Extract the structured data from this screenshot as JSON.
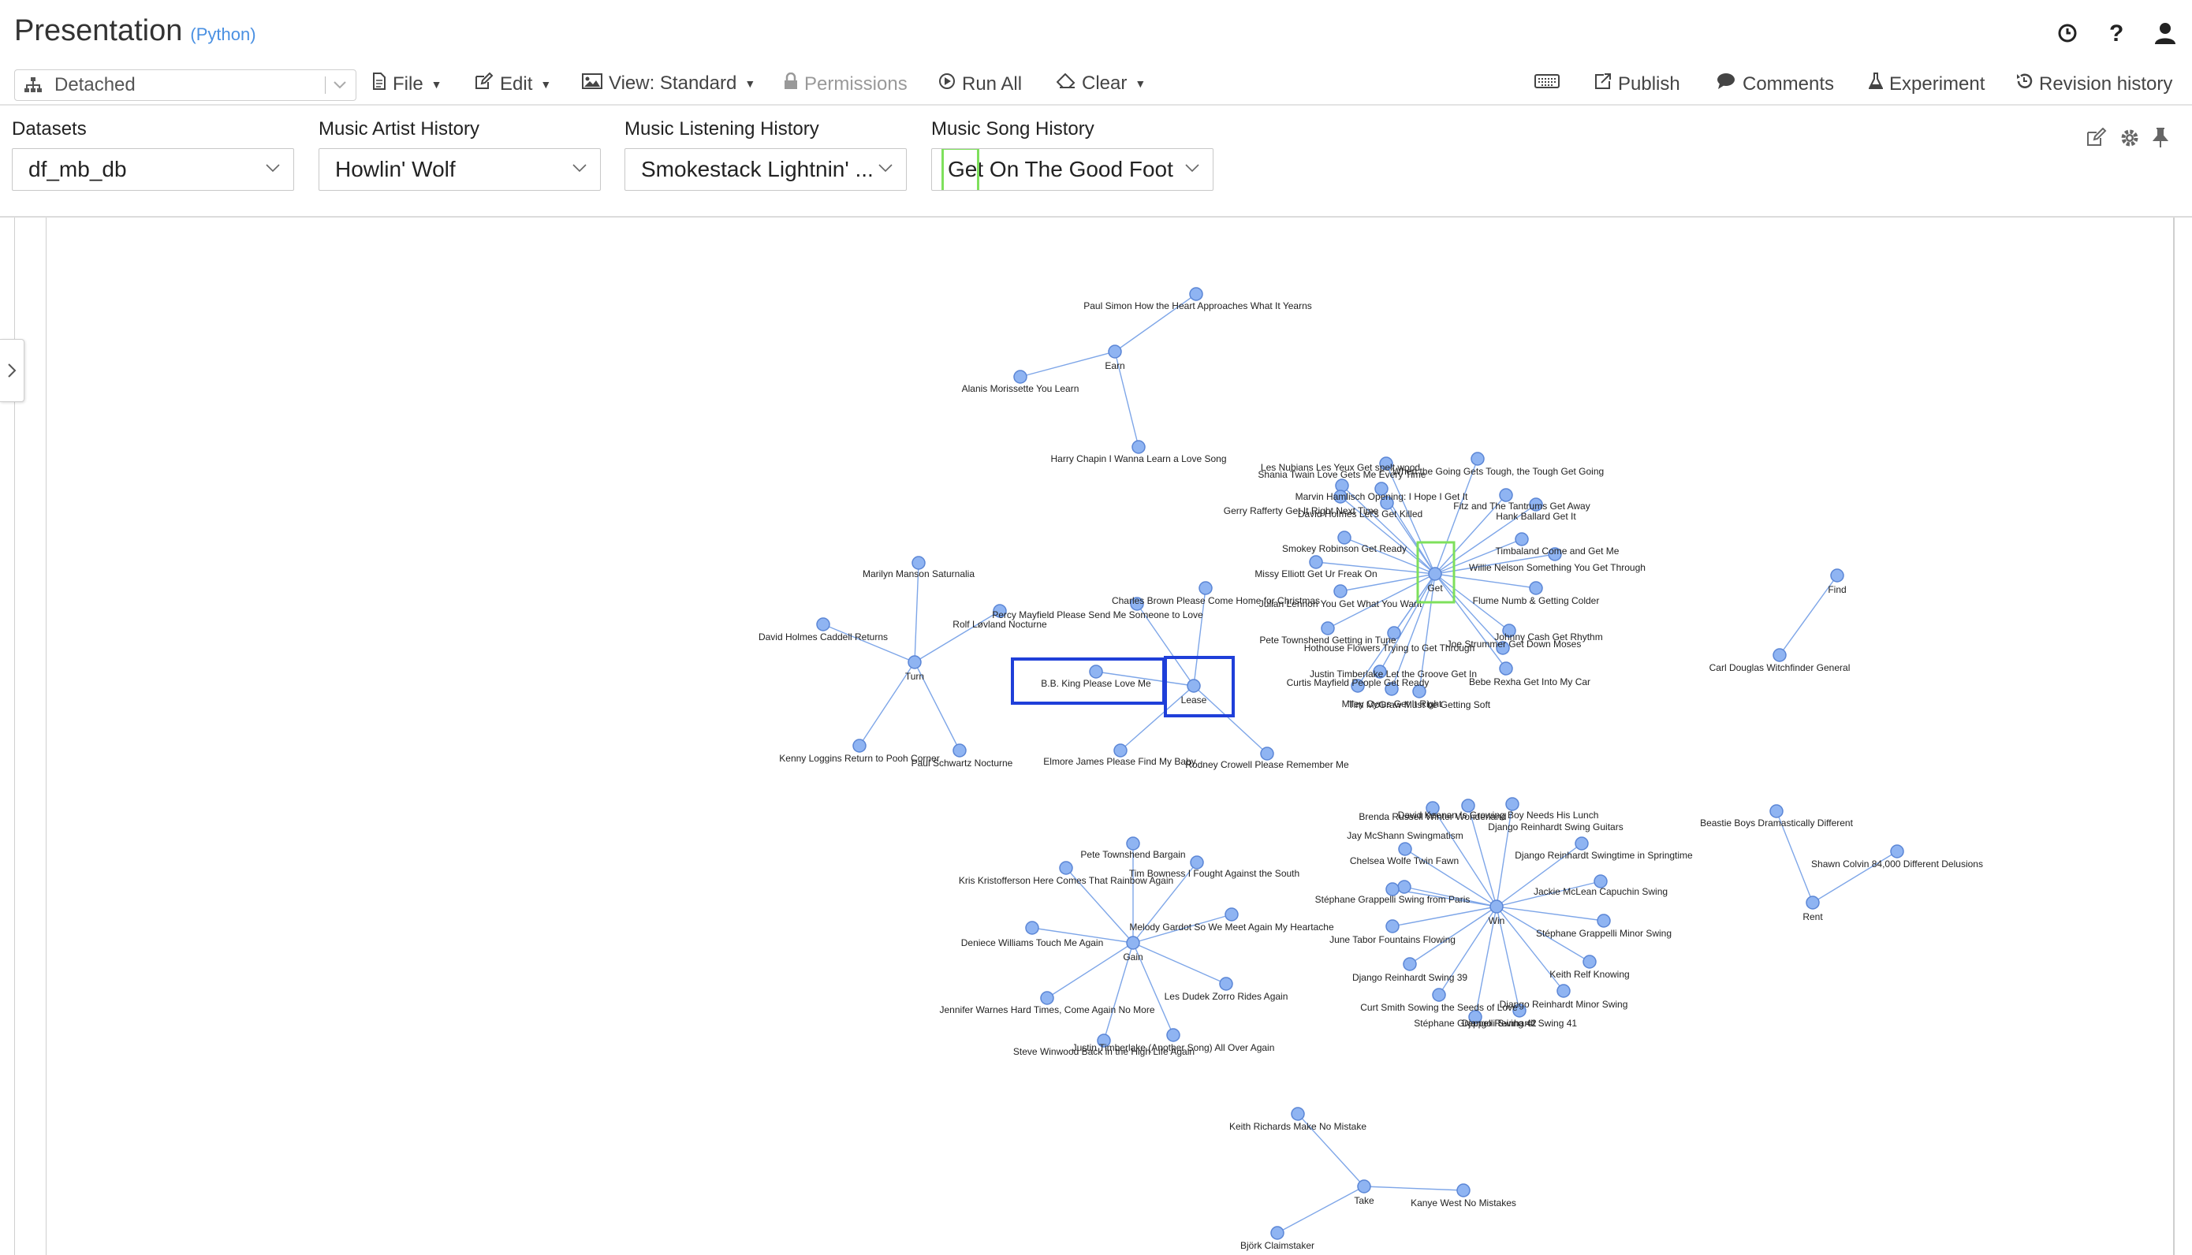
{
  "app": {
    "title": "Presentation",
    "language": "(Python)"
  },
  "toolbar": {
    "kernel": "Detached",
    "file": "File",
    "edit": "Edit",
    "view": "View: Standard",
    "permissions": "Permissions",
    "run_all": "Run All",
    "clear": "Clear",
    "publish": "Publish",
    "comments": "Comments",
    "experiment": "Experiment",
    "revision_history": "Revision history"
  },
  "filters": [
    {
      "label": "Datasets",
      "value": "df_mb_db"
    },
    {
      "label": "Music Artist History",
      "value": "Howlin' Wolf"
    },
    {
      "label": "Music Listening History",
      "value": "Smokestack Lightnin' ..."
    },
    {
      "label": "Music Song History",
      "value": "Get On The Good Foot"
    }
  ],
  "colors": {
    "node_fill": "#8fb4f2",
    "node_stroke": "#5b86d6",
    "edge": "#7ea6e8",
    "highlight_green": "#7ee05c",
    "highlight_blue": "#1f3fd9"
  },
  "graph": {
    "hubs": [
      {
        "id": "earn",
        "label": "Earn"
      },
      {
        "id": "get",
        "label": "Get"
      },
      {
        "id": "turn",
        "label": "Turn"
      },
      {
        "id": "lease",
        "label": "Lease"
      },
      {
        "id": "find",
        "label": "Find"
      },
      {
        "id": "win",
        "label": "Win"
      },
      {
        "id": "gain",
        "label": "Gain"
      },
      {
        "id": "rent",
        "label": "Rent"
      },
      {
        "id": "take",
        "label": "Take"
      }
    ],
    "leaves": [
      {
        "hub": "earn",
        "label": "Paul Simon How the Heart Approaches What It Yearns"
      },
      {
        "hub": "earn",
        "label": "Alanis Morissette You Learn"
      },
      {
        "hub": "earn",
        "label": "Harry Chapin I Wanna Learn a Love Song"
      },
      {
        "hub": "get",
        "label": "Les Nubians Les Yeux Get spelt wood"
      },
      {
        "hub": "get",
        "label": "Shania Twain Love Gets Me Every Time"
      },
      {
        "hub": "get",
        "label": "When the Going Gets Tough, the Tough Get Going"
      },
      {
        "hub": "get",
        "label": "Marvin Hamlisch Opening: I Hope I Get It"
      },
      {
        "hub": "get",
        "label": "Gerry Rafferty Get It Right Next Time"
      },
      {
        "hub": "get",
        "label": "David Holmes Let's Get Killed"
      },
      {
        "hub": "get",
        "label": "Fitz and The Tantrums Get Away"
      },
      {
        "hub": "get",
        "label": "Hank Ballard Get It"
      },
      {
        "hub": "get",
        "label": "Smokey Robinson Get Ready"
      },
      {
        "hub": "get",
        "label": "Timbaland Come and Get Me"
      },
      {
        "hub": "get",
        "label": "Missy Elliott Get Ur Freak On"
      },
      {
        "hub": "get",
        "label": "Willie Nelson Something You Get Through"
      },
      {
        "hub": "get",
        "label": "Julian Lennon You Get What You Want"
      },
      {
        "hub": "get",
        "label": "Flume Numb & Getting Colder"
      },
      {
        "hub": "get",
        "label": "Pete Townshend Getting in Tune"
      },
      {
        "hub": "get",
        "label": "Johnny Cash Get Rhythm"
      },
      {
        "hub": "get",
        "label": "Hothouse Flowers Trying to Get Through"
      },
      {
        "hub": "get",
        "label": "Joe Strummer Get Down Moses"
      },
      {
        "hub": "get",
        "label": "Justin Timberlake Let the Groove Get In"
      },
      {
        "hub": "get",
        "label": "Curtis Mayfield People Get Ready"
      },
      {
        "hub": "get",
        "label": "Bebe Rexha Get Into My Car"
      },
      {
        "hub": "get",
        "label": "Miley Cyrus Get It Right"
      },
      {
        "hub": "get",
        "label": "Tim McGraw Must be Getting Soft"
      },
      {
        "hub": "turn",
        "label": "Marilyn Manson Saturnalia"
      },
      {
        "hub": "turn",
        "label": "David Holmes Caddell Returns"
      },
      {
        "hub": "turn",
        "label": "Rolf Løvland Nocturne"
      },
      {
        "hub": "turn",
        "label": "Kenny Loggins Return to Pooh Corner"
      },
      {
        "hub": "turn",
        "label": "Paul Schwartz Nocturne"
      },
      {
        "hub": "lease",
        "label": "Charles Brown Please Come Home for Christmas"
      },
      {
        "hub": "lease",
        "label": "Percy Mayfield Please Send Me Someone to Love"
      },
      {
        "hub": "lease",
        "label": "B.B. King Please Love Me"
      },
      {
        "hub": "lease",
        "label": "Elmore James Please Find My Baby"
      },
      {
        "hub": "lease",
        "label": "Rodney Crowell Please Remember Me"
      },
      {
        "hub": "find",
        "label": "Carl Douglas Witchfinder General"
      },
      {
        "hub": "win",
        "label": "Brenda Russell Winter Wonderland"
      },
      {
        "hub": "win",
        "label": "David Keenan Is Growing Boy Needs His Lunch"
      },
      {
        "hub": "win",
        "label": "Django Reinhardt Swing Guitars"
      },
      {
        "hub": "win",
        "label": "Jay McShann Swingmatism"
      },
      {
        "hub": "win",
        "label": "Django Reinhardt Swingtime in Springtime"
      },
      {
        "hub": "win",
        "label": "Chelsea Wolfe Twin Fawn"
      },
      {
        "hub": "win",
        "label": "Jackie McLean Capuchin Swing"
      },
      {
        "hub": "win",
        "label": "Stéphane Grappelli Swing from Paris"
      },
      {
        "hub": "win",
        "label": "Stéphane Grappelli Minor Swing"
      },
      {
        "hub": "win",
        "label": "June Tabor Fountains Flowing"
      },
      {
        "hub": "win",
        "label": "Keith Relf Knowing"
      },
      {
        "hub": "win",
        "label": "Django Reinhardt Swing 39"
      },
      {
        "hub": "win",
        "label": "Curt Smith Sowing the Seeds of Love"
      },
      {
        "hub": "win",
        "label": "Django Reinhardt Minor Swing"
      },
      {
        "hub": "win",
        "label": "Stéphane Grappelli Swing 42"
      },
      {
        "hub": "win",
        "label": "Django Reinhardt Swing 41"
      },
      {
        "hub": "gain",
        "label": "Pete Townshend Bargain"
      },
      {
        "hub": "gain",
        "label": "Kris Kristofferson Here Comes That Rainbow Again"
      },
      {
        "hub": "gain",
        "label": "Tim Bowness I Fought Against the South"
      },
      {
        "hub": "gain",
        "label": "Melody Gardot So We Meet Again My Heartache"
      },
      {
        "hub": "gain",
        "label": "Deniece Williams Touch Me Again"
      },
      {
        "hub": "gain",
        "label": "Les Dudek Zorro Rides Again"
      },
      {
        "hub": "gain",
        "label": "Jennifer Warnes Hard Times, Come Again No More"
      },
      {
        "hub": "gain",
        "label": "Justin Timberlake (Another Song) All Over Again"
      },
      {
        "hub": "gain",
        "label": "Steve Winwood Back in the High Life Again"
      },
      {
        "hub": "rent",
        "label": "Beastie Boys Dramastically Different"
      },
      {
        "hub": "rent",
        "label": "Shawn Colvin 84,000 Different Delusions"
      },
      {
        "hub": "take",
        "label": "Keith Richards Make No Mistake"
      },
      {
        "hub": "take",
        "label": "Kanye West No Mistakes"
      },
      {
        "hub": "take",
        "label": "Björk Claimstaker"
      }
    ]
  }
}
